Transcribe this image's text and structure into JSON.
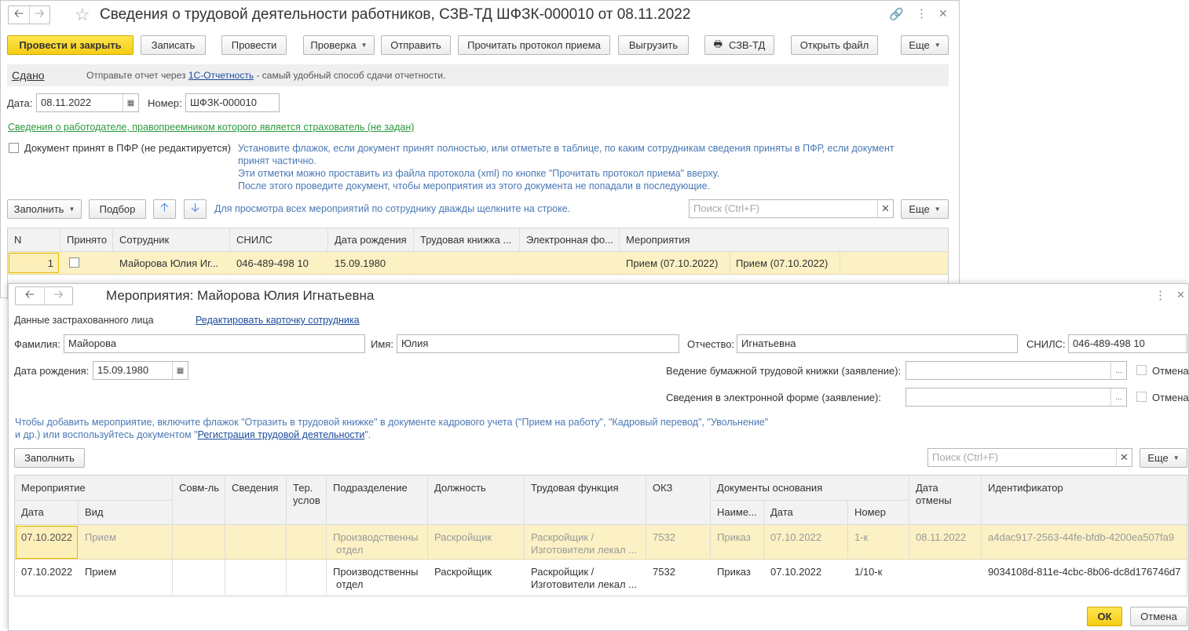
{
  "doc": {
    "title": "Сведения о трудовой деятельности работников, СЗВ-ТД ШФЗК-000010 от 08.11.2022",
    "toolbar": {
      "post_close": "Провести и закрыть",
      "save": "Записать",
      "post": "Провести",
      "check": "Проверка",
      "send": "Отправить",
      "read_protocol": "Прочитать протокол приема",
      "export": "Выгрузить",
      "szv": "СЗВ-ТД",
      "open_file": "Открыть файл",
      "more": "Еще"
    },
    "status": {
      "state": "Сдано",
      "text_before": "Отправьте отчет через",
      "link": "1С-Отчетность",
      "text_after": "- самый удобный способ сдачи отчетности."
    },
    "date_label": "Дата:",
    "date_value": "08.11.2022",
    "number_label": "Номер:",
    "number_value": "ШФЗК-000010",
    "employer_link": "Сведения о работодателе, правопреемником которого является страхователь (не задан)",
    "accepted_label": "Документ принят в ПФР (не редактируется)",
    "hint_lines": [
      "Установите флажок, если документ принят полностью, или отметьте в таблице, по каким сотрудникам сведения приняты в ПФР, если документ",
      "принят частично.",
      "Эти отметки можно проставить из файла протокола (xml) по кнопке \"Прочитать протокол приема\" вверху.",
      "После этого проведите документ, чтобы мероприятия из этого документа не попадали в последующие."
    ],
    "table_toolbar": {
      "fill": "Заполнить",
      "pick": "Подбор",
      "hint": "Для просмотра всех мероприятий по сотруднику дважды щелкните на строке.",
      "search_placeholder": "Поиск (Ctrl+F)",
      "more": "Еще"
    },
    "columns": [
      "N",
      "Принято",
      "Сотрудник",
      "СНИЛС",
      "Дата рождения",
      "Трудовая книжка ...",
      "Электронная фо...",
      "Мероприятия"
    ],
    "rows": [
      {
        "n": "1",
        "employee": "Майорова Юлия Иг...",
        "snils": "046-489-498 10",
        "birth": "15.09.1980",
        "paper": "",
        "electronic": "",
        "event1": "Прием (07.10.2022)",
        "event2": "Прием (07.10.2022)"
      }
    ]
  },
  "dialog": {
    "title": "Мероприятия: Майорова Юлия Игнатьевна",
    "insured_label": "Данные застрахованного лица",
    "edit_link": "Редактировать карточку сотрудника",
    "surname_label": "Фамилия:",
    "surname": "Майорова",
    "name_label": "Имя:",
    "name": "Юлия",
    "patronymic_label": "Отчество:",
    "patronymic": "Игнатьевна",
    "snils_label": "СНИЛС:",
    "snils": "046-489-498 10",
    "birth_label": "Дата рождения:",
    "birth": "15.09.1980",
    "paper_label": "Ведение бумажной трудовой книжки (заявление):",
    "electronic_label": "Сведения в электронной форме (заявление):",
    "cancel_chk": "Отмена",
    "hint_line1": "Чтобы добавить мероприятие, включите флажок \"Отразить в трудовой книжке\" в документе кадрового учета (\"Прием на работу\", \"Кадровый перевод\", \"Увольнение\"",
    "hint_line2_before": "и др.) или воспользуйтесь документом \"",
    "hint_link": "Регистрация трудовой деятельности",
    "hint_line2_after": "\".",
    "fill": "Заполнить",
    "search_placeholder": "Поиск (Ctrl+F)",
    "more": "Еще",
    "headers": {
      "event": "Мероприятие",
      "date": "Дата",
      "kind": "Вид",
      "combo": "Совм-ль",
      "info": "Сведения",
      "terr1": "Тер.",
      "terr2": "услов",
      "dept": "Подразделение",
      "position": "Должность",
      "func": "Трудовая функция",
      "okz": "ОКЗ",
      "docs": "Документы основания",
      "doc_name": "Наиме...",
      "doc_date": "Дата",
      "doc_num": "Номер",
      "cancel1": "Дата",
      "cancel2": "отмены",
      "id": "Идентификатор"
    },
    "rows": [
      {
        "date": "07.10.2022",
        "kind": "Прием",
        "dept1": "Производственны",
        "dept2": "отдел",
        "position": "Раскройщик",
        "func1": "Раскройщик /",
        "func2": "Изготовители лекал ...",
        "okz": "7532",
        "doc_name": "Приказ",
        "doc_date": "07.10.2022",
        "doc_num": "1-к",
        "cancel_date": "08.11.2022",
        "id": "a4dac917-2563-44fe-bfdb-4200ea507fa9"
      },
      {
        "date": "07.10.2022",
        "kind": "Прием",
        "dept1": "Производственны",
        "dept2": "отдел",
        "position": "Раскройщик",
        "func1": "Раскройщик /",
        "func2": "Изготовители лекал ...",
        "okz": "7532",
        "doc_name": "Приказ",
        "doc_date": "07.10.2022",
        "doc_num": "1/10-к",
        "cancel_date": "",
        "id": "9034108d-811e-4cbc-8b06-dc8d176746d7"
      }
    ],
    "ok": "ОК",
    "cancel": "Отмена"
  }
}
